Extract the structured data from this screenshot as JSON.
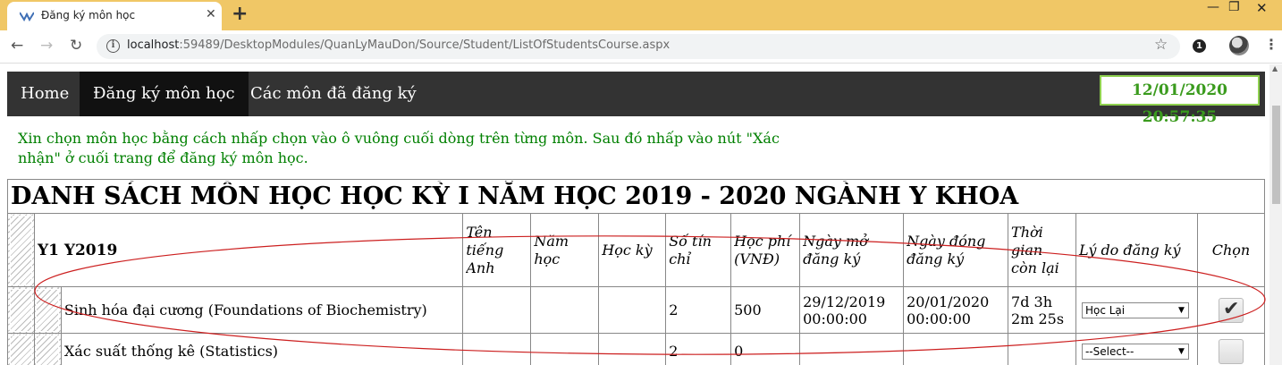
{
  "browser": {
    "tab_title": "Đăng ký môn học",
    "tab_close": "✕",
    "new_tab": "+",
    "url_host": "localhost",
    "url_rest": ":59489/DesktopModules/QuanLyMauDon/Source/Student/ListOfStudentsCourse.aspx",
    "extension_badge": "1"
  },
  "nav": {
    "items": [
      "Home",
      "Đăng ký môn học",
      "Các môn đã đăng ký"
    ],
    "active_index": 1,
    "clock": "12/01/2020 20:57:35"
  },
  "instructions": "Xin chọn môn học bằng cách nhấp chọn vào ô vuông cuối dòng trên từng môn. Sau đó nhấp vào nút \"Xác nhận\" ở cuối trang để đăng ký môn học.",
  "table": {
    "title": "DANH SÁCH MÔN HỌC HỌC KỲ I NĂM HỌC 2019 - 2020 NGÀNH Y KHOA",
    "group_label": "Y1 Y2019",
    "headers": {
      "english_name": "Tên tiếng Anh",
      "year": "Năm học",
      "semester": "Học kỳ",
      "credits": "Số tín chỉ",
      "fee": "Học phí (VNĐ)",
      "open_date": "Ngày mở đăng ký",
      "close_date": "Ngày đóng đăng ký",
      "remaining": "Thời gian còn lại",
      "reason": "Lý do đăng ký",
      "choose": "Chọn"
    },
    "rows": [
      {
        "name": "Sinh hóa đại cương (Foundations of Biochemistry)",
        "english_name": "",
        "year": "",
        "semester": "",
        "credits": "2",
        "fee": "500",
        "open_date": "29/12/2019 00:00:00",
        "close_date": "20/01/2020 00:00:00",
        "remaining": "7d 3h 2m 25s",
        "reason": "Học Lại",
        "checked": true
      },
      {
        "name": "Xác suất thống kê (Statistics)",
        "english_name": "",
        "year": "",
        "semester": "",
        "credits": "2",
        "fee": "0",
        "open_date": "",
        "close_date": "",
        "remaining": "",
        "reason": "--Select--",
        "checked": false
      }
    ]
  },
  "colors": {
    "tabstrip": "#f0c766",
    "nav_bg": "#333333",
    "nav_active": "#111111",
    "clock_text": "#3a9b1d",
    "instructions": "#008000",
    "annotation": "#cc1f1f"
  }
}
